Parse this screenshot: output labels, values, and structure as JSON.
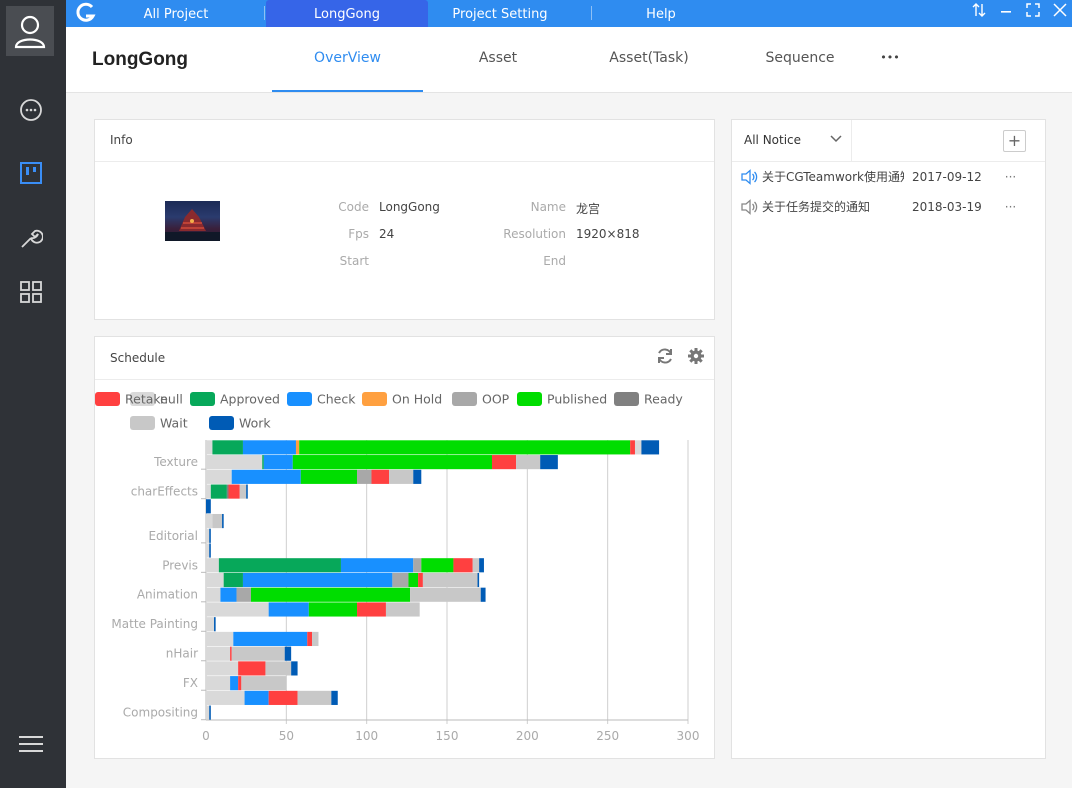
{
  "topbar": {
    "tabs": [
      {
        "label": "All Project",
        "active": false
      },
      {
        "label": "LongGong",
        "active": true
      },
      {
        "label": "Project Setting",
        "active": false
      },
      {
        "label": "Help",
        "active": false
      }
    ]
  },
  "header": {
    "project_title": "LongGong",
    "tabs": [
      {
        "label": "OverView",
        "active": true
      },
      {
        "label": "Asset",
        "active": false
      },
      {
        "label": "Asset(Task)",
        "active": false
      },
      {
        "label": "Sequence",
        "active": false
      }
    ],
    "more_label": "•••"
  },
  "info": {
    "title": "Info",
    "fields": {
      "code_label": "Code",
      "code_value": "LongGong",
      "name_label": "Name",
      "name_value": "龙宫",
      "fps_label": "Fps",
      "fps_value": "24",
      "resolution_label": "Resolution",
      "resolution_value": "1920×818",
      "start_label": "Start",
      "start_value": "",
      "end_label": "End",
      "end_value": ""
    }
  },
  "notices": {
    "filter_label": "All Notice",
    "add_label": "+",
    "items": [
      {
        "title": "关于CGTeamwork使用通知",
        "date": "2017-09-12",
        "more": "···",
        "active": true
      },
      {
        "title": "关于任务提交的通知",
        "date": "2018-03-19",
        "more": "···",
        "active": false
      }
    ]
  },
  "schedule": {
    "title": "Schedule"
  },
  "colors": {
    "accent": "#2f8cf0",
    "null": "#d9d9d9",
    "Approved": "#07a85a",
    "Check": "#1890ff",
    "On Hold": "#ffa040",
    "OOP": "#a8a8a8",
    "Published": "#00dd00",
    "Ready": "#808080",
    "Retake": "#ff4040",
    "Wait": "#c8c8c8",
    "Work": "#005bb5"
  },
  "chart_data": {
    "type": "bar",
    "orientation": "horizontal",
    "stacked": true,
    "legend": [
      "null",
      "Approved",
      "Check",
      "On Hold",
      "OOP",
      "Published",
      "Ready",
      "Retake",
      "Wait",
      "Work"
    ],
    "legend_position": "top",
    "xlim": [
      0,
      300
    ],
    "xticks": [
      0,
      50,
      100,
      150,
      200,
      250,
      300
    ],
    "grid": true,
    "category_labels": [
      "Texture",
      "charEffects",
      "",
      "Editorial",
      "Previs",
      "Animation",
      "Matte Painting",
      "nHair",
      "FX",
      "Compositing"
    ],
    "rows": [
      {
        "label": "",
        "segments": [
          [
            "null",
            4
          ],
          [
            "Approved",
            19
          ],
          [
            "Check",
            33
          ],
          [
            "On Hold",
            2
          ],
          [
            "Published",
            206
          ],
          [
            "Retake",
            3
          ],
          [
            "null",
            4
          ],
          [
            "Work",
            11
          ]
        ]
      },
      {
        "label": "Texture",
        "segments": [
          [
            "null",
            35
          ],
          [
            "Approved",
            1
          ],
          [
            "Check",
            18
          ],
          [
            "Published",
            124
          ],
          [
            "Retake",
            15
          ],
          [
            "Wait",
            15
          ],
          [
            "Work",
            11
          ]
        ]
      },
      {
        "label": "",
        "segments": [
          [
            "null",
            16
          ],
          [
            "Check",
            43
          ],
          [
            "Published",
            35
          ],
          [
            "OOP",
            9
          ],
          [
            "Retake",
            11
          ],
          [
            "Wait",
            15
          ],
          [
            "Work",
            5
          ]
        ]
      },
      {
        "label": "charEffects",
        "segments": [
          [
            "null",
            3
          ],
          [
            "Approved",
            10
          ],
          [
            "Ready",
            1
          ],
          [
            "Retake",
            7
          ],
          [
            "Wait",
            4
          ],
          [
            "Work",
            1
          ]
        ]
      },
      {
        "label": "",
        "segments": [
          [
            "Work",
            3
          ]
        ]
      },
      {
        "label": "",
        "segments": [
          [
            "null",
            4
          ],
          [
            "Wait",
            6
          ],
          [
            "Work",
            1
          ]
        ]
      },
      {
        "label": "Editorial",
        "segments": [
          [
            "null",
            2
          ],
          [
            "Work",
            1
          ]
        ]
      },
      {
        "label": "",
        "segments": [
          [
            "null",
            2
          ],
          [
            "Work",
            1
          ]
        ]
      },
      {
        "label": "Previs",
        "segments": [
          [
            "null",
            8
          ],
          [
            "Approved",
            76
          ],
          [
            "Check",
            45
          ],
          [
            "OOP",
            5
          ],
          [
            "Published",
            20
          ],
          [
            "Retake",
            12
          ],
          [
            "Wait",
            4
          ],
          [
            "Work",
            3
          ]
        ]
      },
      {
        "label": "",
        "segments": [
          [
            "null",
            11
          ],
          [
            "Approved",
            12
          ],
          [
            "Check",
            93
          ],
          [
            "OOP",
            10
          ],
          [
            "Published",
            6
          ],
          [
            "Retake",
            3
          ],
          [
            "Wait",
            34
          ],
          [
            "Work",
            1
          ]
        ]
      },
      {
        "label": "Animation",
        "segments": [
          [
            "null",
            9
          ],
          [
            "Check",
            10
          ],
          [
            "OOP",
            9
          ],
          [
            "Published",
            99
          ],
          [
            "Wait",
            44
          ],
          [
            "Work",
            3
          ]
        ]
      },
      {
        "label": "",
        "segments": [
          [
            "null",
            39
          ],
          [
            "Check",
            25
          ],
          [
            "Published",
            30
          ],
          [
            "Retake",
            18
          ],
          [
            "Wait",
            21
          ]
        ]
      },
      {
        "label": "Matte Painting",
        "segments": [
          [
            "null",
            5
          ],
          [
            "Work",
            1
          ]
        ]
      },
      {
        "label": "",
        "segments": [
          [
            "null",
            17
          ],
          [
            "Check",
            46
          ],
          [
            "Retake",
            3
          ],
          [
            "Wait",
            4
          ]
        ]
      },
      {
        "label": "nHair",
        "segments": [
          [
            "null",
            15
          ],
          [
            "Retake",
            1
          ],
          [
            "Wait",
            33
          ],
          [
            "Work",
            4
          ]
        ]
      },
      {
        "label": "",
        "segments": [
          [
            "null",
            20
          ],
          [
            "Retake",
            17
          ],
          [
            "Wait",
            16
          ],
          [
            "Work",
            4
          ]
        ]
      },
      {
        "label": "FX",
        "segments": [
          [
            "null",
            15
          ],
          [
            "Check",
            5
          ],
          [
            "Retake",
            2
          ],
          [
            "Wait",
            28
          ]
        ]
      },
      {
        "label": "",
        "segments": [
          [
            "null",
            24
          ],
          [
            "Check",
            15
          ],
          [
            "Retake",
            18
          ],
          [
            "Wait",
            21
          ],
          [
            "Work",
            4
          ]
        ]
      },
      {
        "label": "Compositing",
        "segments": [
          [
            "null",
            2
          ],
          [
            "Work",
            1
          ]
        ]
      }
    ]
  }
}
